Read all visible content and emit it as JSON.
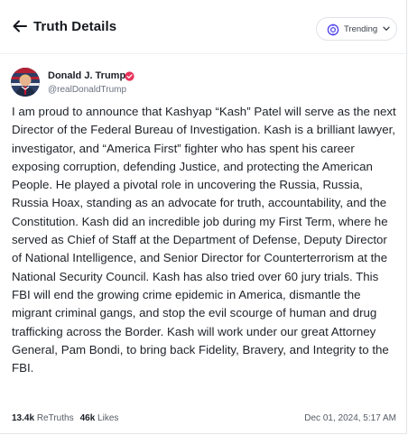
{
  "header": {
    "title": "Truth Details",
    "trending_label": "Trending"
  },
  "post": {
    "author_name": "Donald J. Trump",
    "handle": "@realDonaldTrump",
    "text": "I am proud to announce that Kashyap “Kash” Patel will serve as the next Director of the Federal Bureau of Investigation. Kash is a brilliant lawyer, investigator, and “America First” fighter who has spent his career exposing corruption, defending Justice, and protecting the American People. He played a pivotal role in uncovering the Russia, Russia, Russia Hoax, standing as an advocate for truth, accountability, and the Constitution. Kash did an incredible job during my First Term, where he served as Chief of Staff at the Department of Defense, Deputy Director of National Intelligence, and Senior Director for Counterterrorism at the National Security Council. Kash has also tried over 60 jury trials. This FBI will end the growing crime epidemic in America, dismantle the migrant criminal gangs, and stop the evil scourge of human and drug trafficking across the Border. Kash will work under our great Attorney General, Pam Bondi, to bring back Fidelity, Bravery, and Integrity to the FBI.",
    "retruths_count": "13.4k",
    "retruths_label": "ReTruths",
    "likes_count": "46k",
    "likes_label": "Likes",
    "timestamp": "Dec 01, 2024, 5:17 AM"
  },
  "colors": {
    "verified_badge": "#e8335b",
    "accent_icon": "#5448ee"
  },
  "icons": {
    "back": "arrow-left-icon",
    "trending": "trending-icon",
    "dropdown": "chevron-down-icon",
    "verified": "verified-badge-icon"
  }
}
